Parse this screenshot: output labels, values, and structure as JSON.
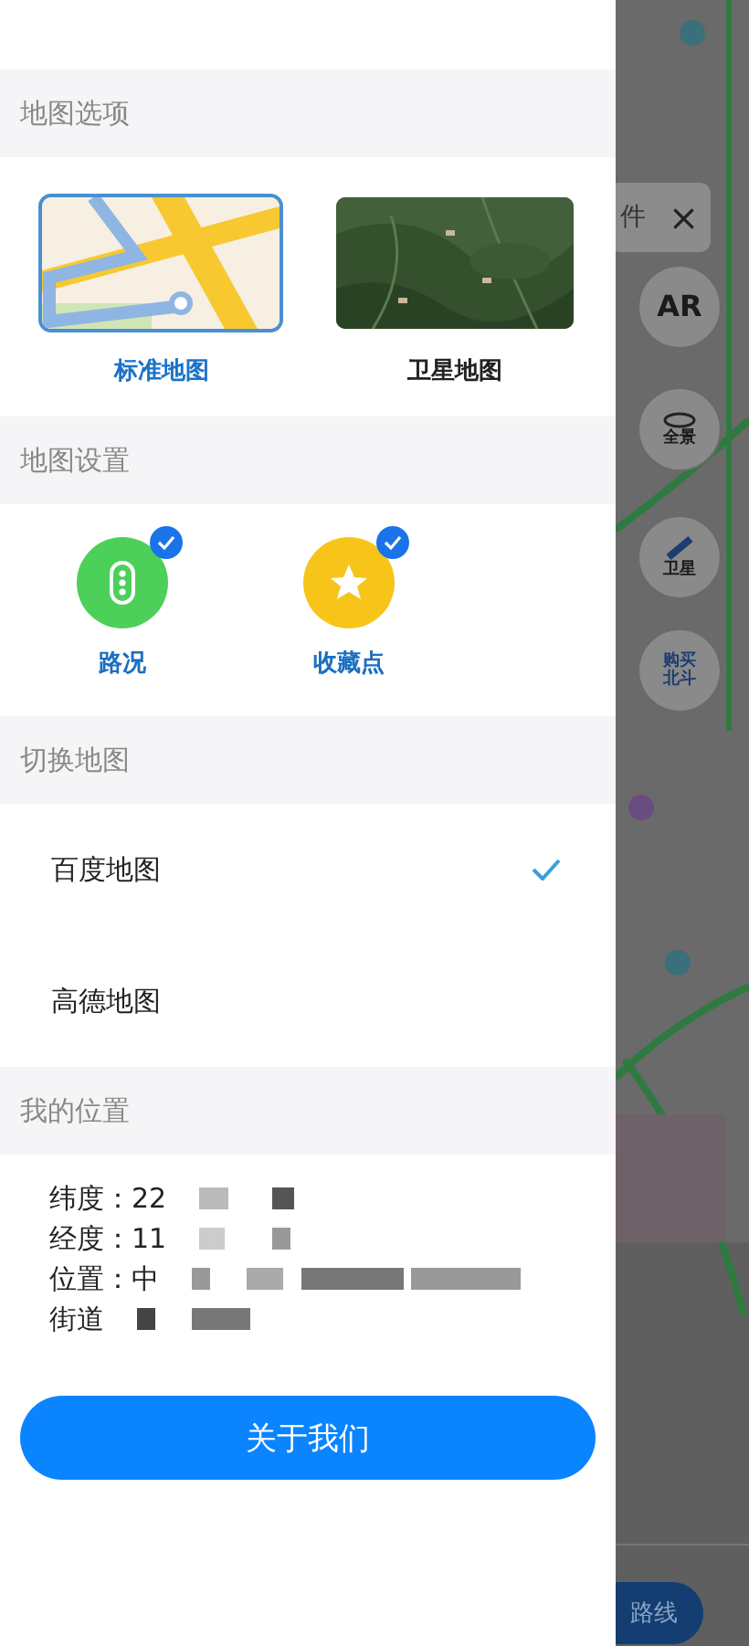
{
  "map_options": {
    "title": "地图选项",
    "options": [
      {
        "label": "标准地图",
        "kind": "standard",
        "selected": true
      },
      {
        "label": "卫星地图",
        "kind": "satellite",
        "selected": false
      }
    ]
  },
  "map_settings": {
    "title": "地图设置",
    "items": [
      {
        "label": "路况",
        "kind": "traffic",
        "checked": true
      },
      {
        "label": "收藏点",
        "kind": "favorite",
        "checked": true
      }
    ]
  },
  "switch_map": {
    "title": "切换地图",
    "items": [
      {
        "label": "百度地图",
        "selected": true
      },
      {
        "label": "高德地图",
        "selected": false
      }
    ]
  },
  "my_location": {
    "title": "我的位置",
    "lines": [
      {
        "text": "纬度：22",
        "redacted": true
      },
      {
        "text": "经度：11",
        "redacted": true
      },
      {
        "text": "位置：中",
        "redacted": true
      },
      {
        "text": "街道",
        "redacted": true
      }
    ]
  },
  "about_button": "关于我们",
  "map_overlay": {
    "search_chip": "件",
    "close": "×",
    "buttons": [
      {
        "kind": "text",
        "label": "AR"
      },
      {
        "kind": "pano",
        "label": "全景"
      },
      {
        "kind": "satellite",
        "label": "卫星"
      },
      {
        "kind": "text",
        "label": "购买北斗"
      }
    ],
    "route_button": "路线"
  }
}
